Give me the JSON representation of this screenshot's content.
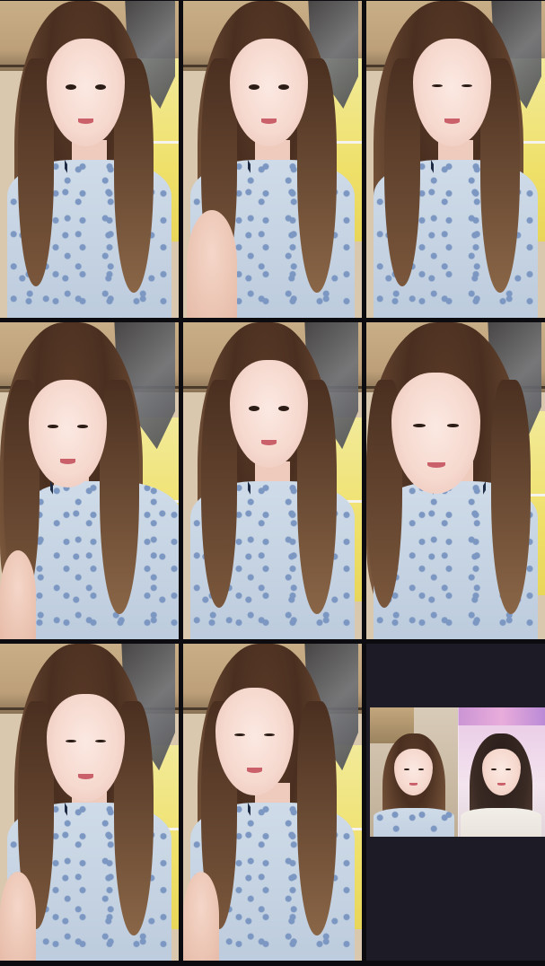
{
  "screen": {
    "layout": "video-grid-3x3"
  },
  "tiles": [
    {
      "slot": 1,
      "type": "video",
      "content": "participant-video"
    },
    {
      "slot": 2,
      "type": "video",
      "content": "participant-video"
    },
    {
      "slot": 3,
      "type": "video",
      "content": "participant-video"
    },
    {
      "slot": 4,
      "type": "video",
      "content": "participant-video"
    },
    {
      "slot": 5,
      "type": "video",
      "content": "participant-video"
    },
    {
      "slot": 6,
      "type": "video",
      "content": "participant-video"
    },
    {
      "slot": 7,
      "type": "video",
      "content": "participant-video"
    },
    {
      "slot": 8,
      "type": "video",
      "content": "participant-video"
    },
    {
      "slot": 9,
      "type": "empty-with-inset",
      "content": "inset-video"
    }
  ],
  "colors": {
    "background": "#0c0c10",
    "empty_tile": "#1d1c26",
    "window_yellow": "#efe06a",
    "shirt_blue": "#bccbdd"
  }
}
